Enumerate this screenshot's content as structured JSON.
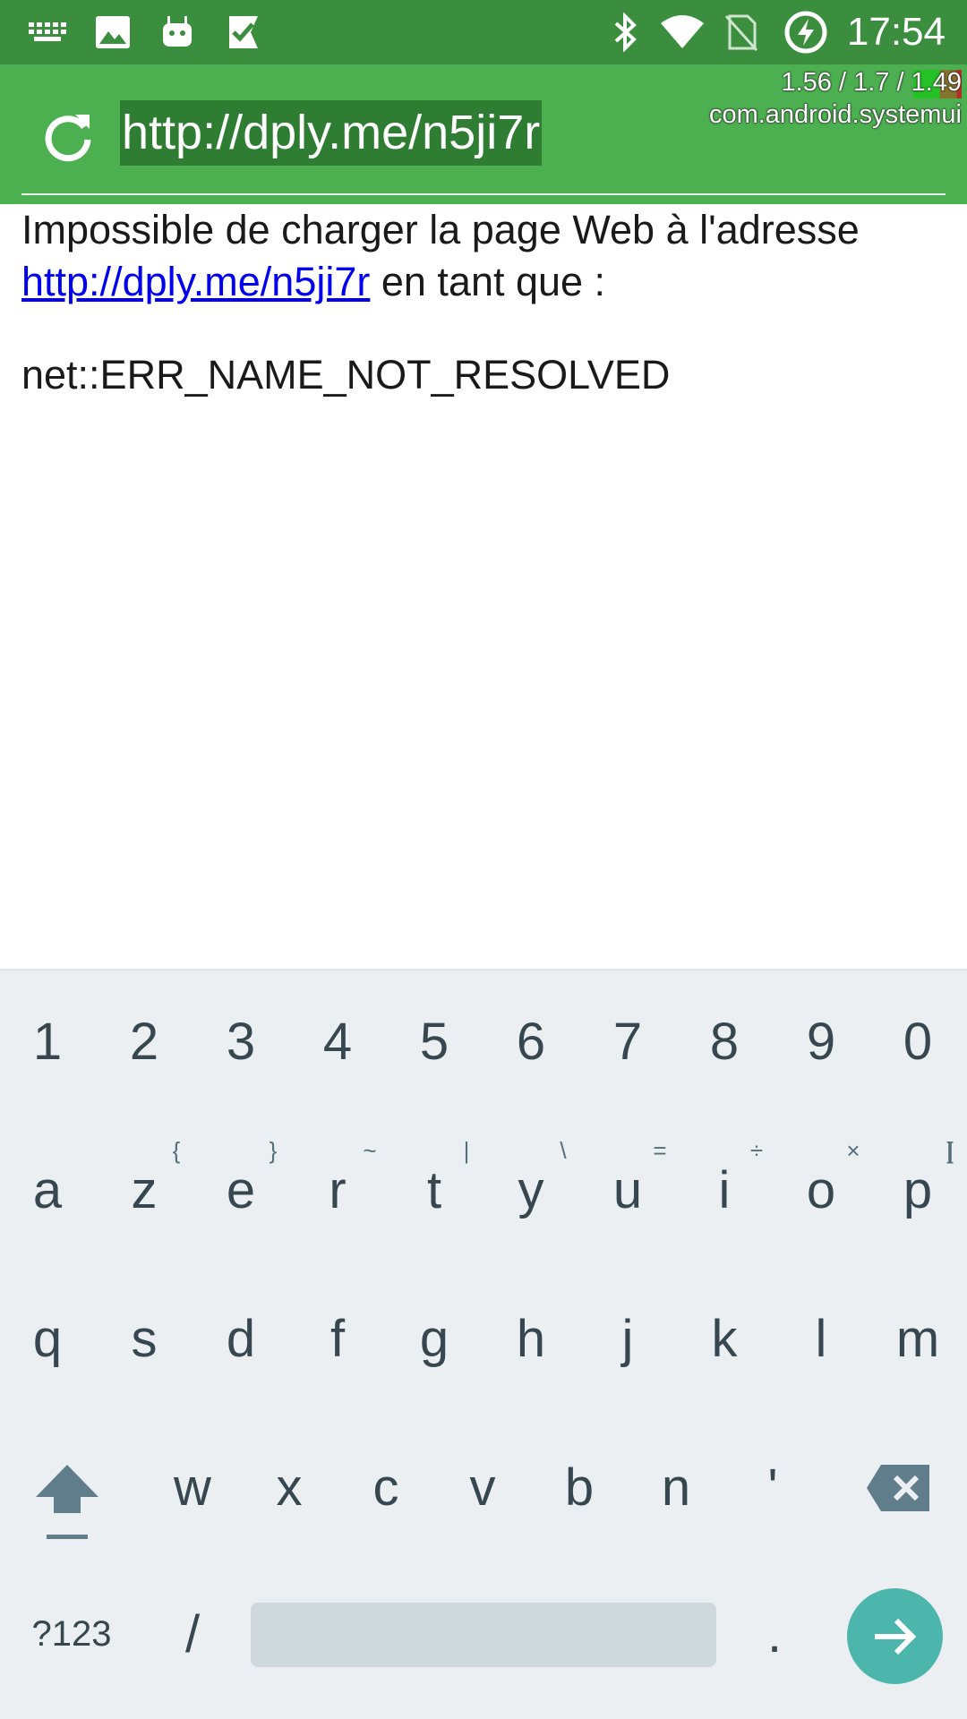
{
  "status_bar": {
    "time": "17:54",
    "icons": [
      "keyboard-icon",
      "image-icon",
      "android-icon",
      "check-flag-icon",
      "bluetooth-icon",
      "wifi-icon",
      "no-sim-icon",
      "battery-charging-icon"
    ]
  },
  "toolbar": {
    "url": "http://dply.me/n5ji7r",
    "overlay_stats": "1.56 / 1.7 / 1.49",
    "overlay_package": "com.android.systemui"
  },
  "page": {
    "line1": "Impossible de charger la page Web à l'adresse",
    "link": "http://dply.me/n5ji7r",
    "line2_rest": " en tant que :",
    "error": "net::ERR_NAME_NOT_RESOLVED"
  },
  "keyboard": {
    "row_numbers": [
      "1",
      "2",
      "3",
      "4",
      "5",
      "6",
      "7",
      "8",
      "9",
      "0"
    ],
    "row1": [
      {
        "key": "a",
        "hint": ""
      },
      {
        "key": "z",
        "hint": "{"
      },
      {
        "key": "e",
        "hint": "}"
      },
      {
        "key": "r",
        "hint": "~"
      },
      {
        "key": "t",
        "hint": "|"
      },
      {
        "key": "y",
        "hint": "\\"
      },
      {
        "key": "u",
        "hint": "="
      },
      {
        "key": "i",
        "hint": "÷"
      },
      {
        "key": "o",
        "hint": "×"
      },
      {
        "key": "p",
        "hint": "["
      }
    ],
    "row1_extra_hint": "]",
    "row2": [
      "q",
      "s",
      "d",
      "f",
      "g",
      "h",
      "j",
      "k",
      "l",
      "m"
    ],
    "row3": [
      "w",
      "x",
      "c",
      "v",
      "b",
      "n",
      "'"
    ],
    "symbols_label": "?123",
    "slash_label": "/",
    "period_label": "."
  },
  "colors": {
    "status_bar": "#3b8e3e",
    "toolbar": "#4caf50",
    "url_highlight": "#2e7d32",
    "link": "#0000ee",
    "keyboard_bg": "#eceff1",
    "enter_key": "#4db6ac"
  }
}
